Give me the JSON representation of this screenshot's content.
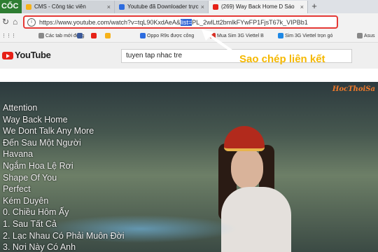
{
  "tabs": {
    "side_label": "CỐC",
    "items": [
      {
        "title": "CMS - Công tác viên",
        "favicon_color": "#f6b21a"
      },
      {
        "title": "Youtube đã Downloader trực",
        "favicon_color": "#2d6cdf"
      },
      {
        "title": "(269) Way Back Home D Sáo",
        "favicon_color": "#e62117"
      }
    ],
    "close_glyph": "×",
    "new_tab_glyph": "+"
  },
  "address_bar": {
    "url_prefix": "https://www.youtube.com/watch?v=tqL90KxdAeA&",
    "url_selected": "list=",
    "url_suffix": "PL_2wlLtt2bmlkFYwFP1FjsT67k_VIPBb1",
    "highlight_color": "#3367d6"
  },
  "bookmarks": [
    {
      "label": "Các tab mới đóng",
      "icon_color": "#888888"
    },
    {
      "label": "",
      "icon_color": "#3b5998"
    },
    {
      "label": "",
      "icon_color": "#e62117"
    },
    {
      "label": "",
      "icon_color": "#f6b21a"
    },
    {
      "label": "Oppo R9s được công",
      "icon_color": "#2d6cdf"
    },
    {
      "label": "Mua Sim 3G Viettel B",
      "icon_color": "#d93025"
    },
    {
      "label": "Sim 3G Viettel trọn gó",
      "icon_color": "#1e88e5"
    },
    {
      "label": "Asus",
      "icon_color": "#888888"
    }
  ],
  "youtube": {
    "logo_text": "YouTube",
    "search_value": "tuyen tap nhac tre"
  },
  "callout": {
    "text": "Sao chép liên kết",
    "color": "#f5b800"
  },
  "video": {
    "watermark": "HocThoiSa",
    "songs": [
      "Attention",
      "Way Back Home",
      "We Dont Talk Any More",
      "Đến Sau Một Người",
      "Havana",
      "Ngắm Hoa Lệ Rơi",
      "Shape Of You",
      "Perfect",
      "Kém Duyên",
      "0. Chiều Hôm Ấy",
      "1. Sau Tất Cả",
      "2. Lạc Nhau Có Phải Muôn Đời",
      "3. Nơi Này Có Anh"
    ]
  }
}
